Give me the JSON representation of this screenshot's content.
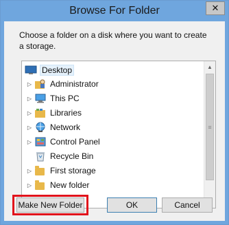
{
  "window": {
    "title": "Browse For Folder",
    "close_glyph": "✕"
  },
  "description": "Choose a folder on a disk where you want to create a storage.",
  "tree": {
    "items": [
      {
        "label": "Desktop",
        "icon": "desktop-icon",
        "expandable": false,
        "selected": true
      },
      {
        "label": "Administrator",
        "icon": "user-folder-icon",
        "expandable": true
      },
      {
        "label": "This PC",
        "icon": "computer-icon",
        "expandable": true
      },
      {
        "label": "Libraries",
        "icon": "libraries-icon",
        "expandable": true
      },
      {
        "label": "Network",
        "icon": "network-icon",
        "expandable": true
      },
      {
        "label": "Control Panel",
        "icon": "control-panel-icon",
        "expandable": true
      },
      {
        "label": "Recycle Bin",
        "icon": "recycle-bin-icon",
        "expandable": false
      },
      {
        "label": "First storage",
        "icon": "folder-icon",
        "expandable": true
      },
      {
        "label": "New folder",
        "icon": "folder-icon",
        "expandable": true
      }
    ],
    "expand_glyph": "▷",
    "scroll_up_glyph": "▲",
    "scroll_down_glyph": "▼",
    "thumb_grip_glyph": "≡"
  },
  "buttons": {
    "make_new_folder": "Make New Folder",
    "ok": "OK",
    "cancel": "Cancel"
  },
  "colors": {
    "title_bar": "#6fa6de",
    "highlight": "#e1121b",
    "selection": "#e5f1fb"
  }
}
